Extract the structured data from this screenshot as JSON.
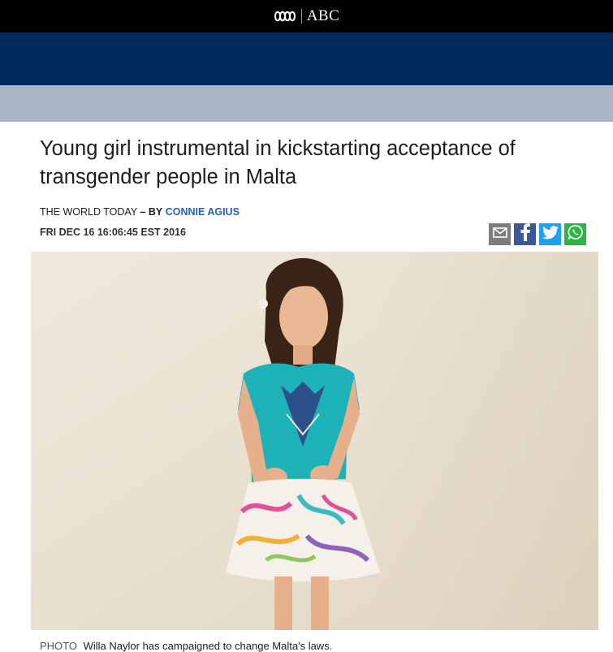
{
  "brand": {
    "name": "ABC"
  },
  "colors": {
    "topbar": "#000000",
    "navbar": "#002a5c",
    "subnav": "#a9b4c5",
    "author_link": "#2a5db0",
    "facebook": "#3b5998",
    "twitter": "#1da1f2",
    "whatsapp": "#2bb741",
    "email": "#7d7d7d"
  },
  "article": {
    "headline": "Young girl instrumental in kickstarting acceptance of transgender people in Malta",
    "program": "THE WORLD TODAY",
    "byline_sep": "– BY",
    "author": "CONNIE AGIUS",
    "dateline": "FRI DEC 16 16:06:45 EST 2016"
  },
  "share": {
    "items": [
      {
        "icon": "email-icon"
      },
      {
        "icon": "facebook-icon"
      },
      {
        "icon": "twitter-icon"
      },
      {
        "icon": "whatsapp-icon"
      }
    ]
  },
  "photo": {
    "caption_label": "PHOTO",
    "caption": "Willa Naylor has campaigned to change Malta's laws."
  }
}
